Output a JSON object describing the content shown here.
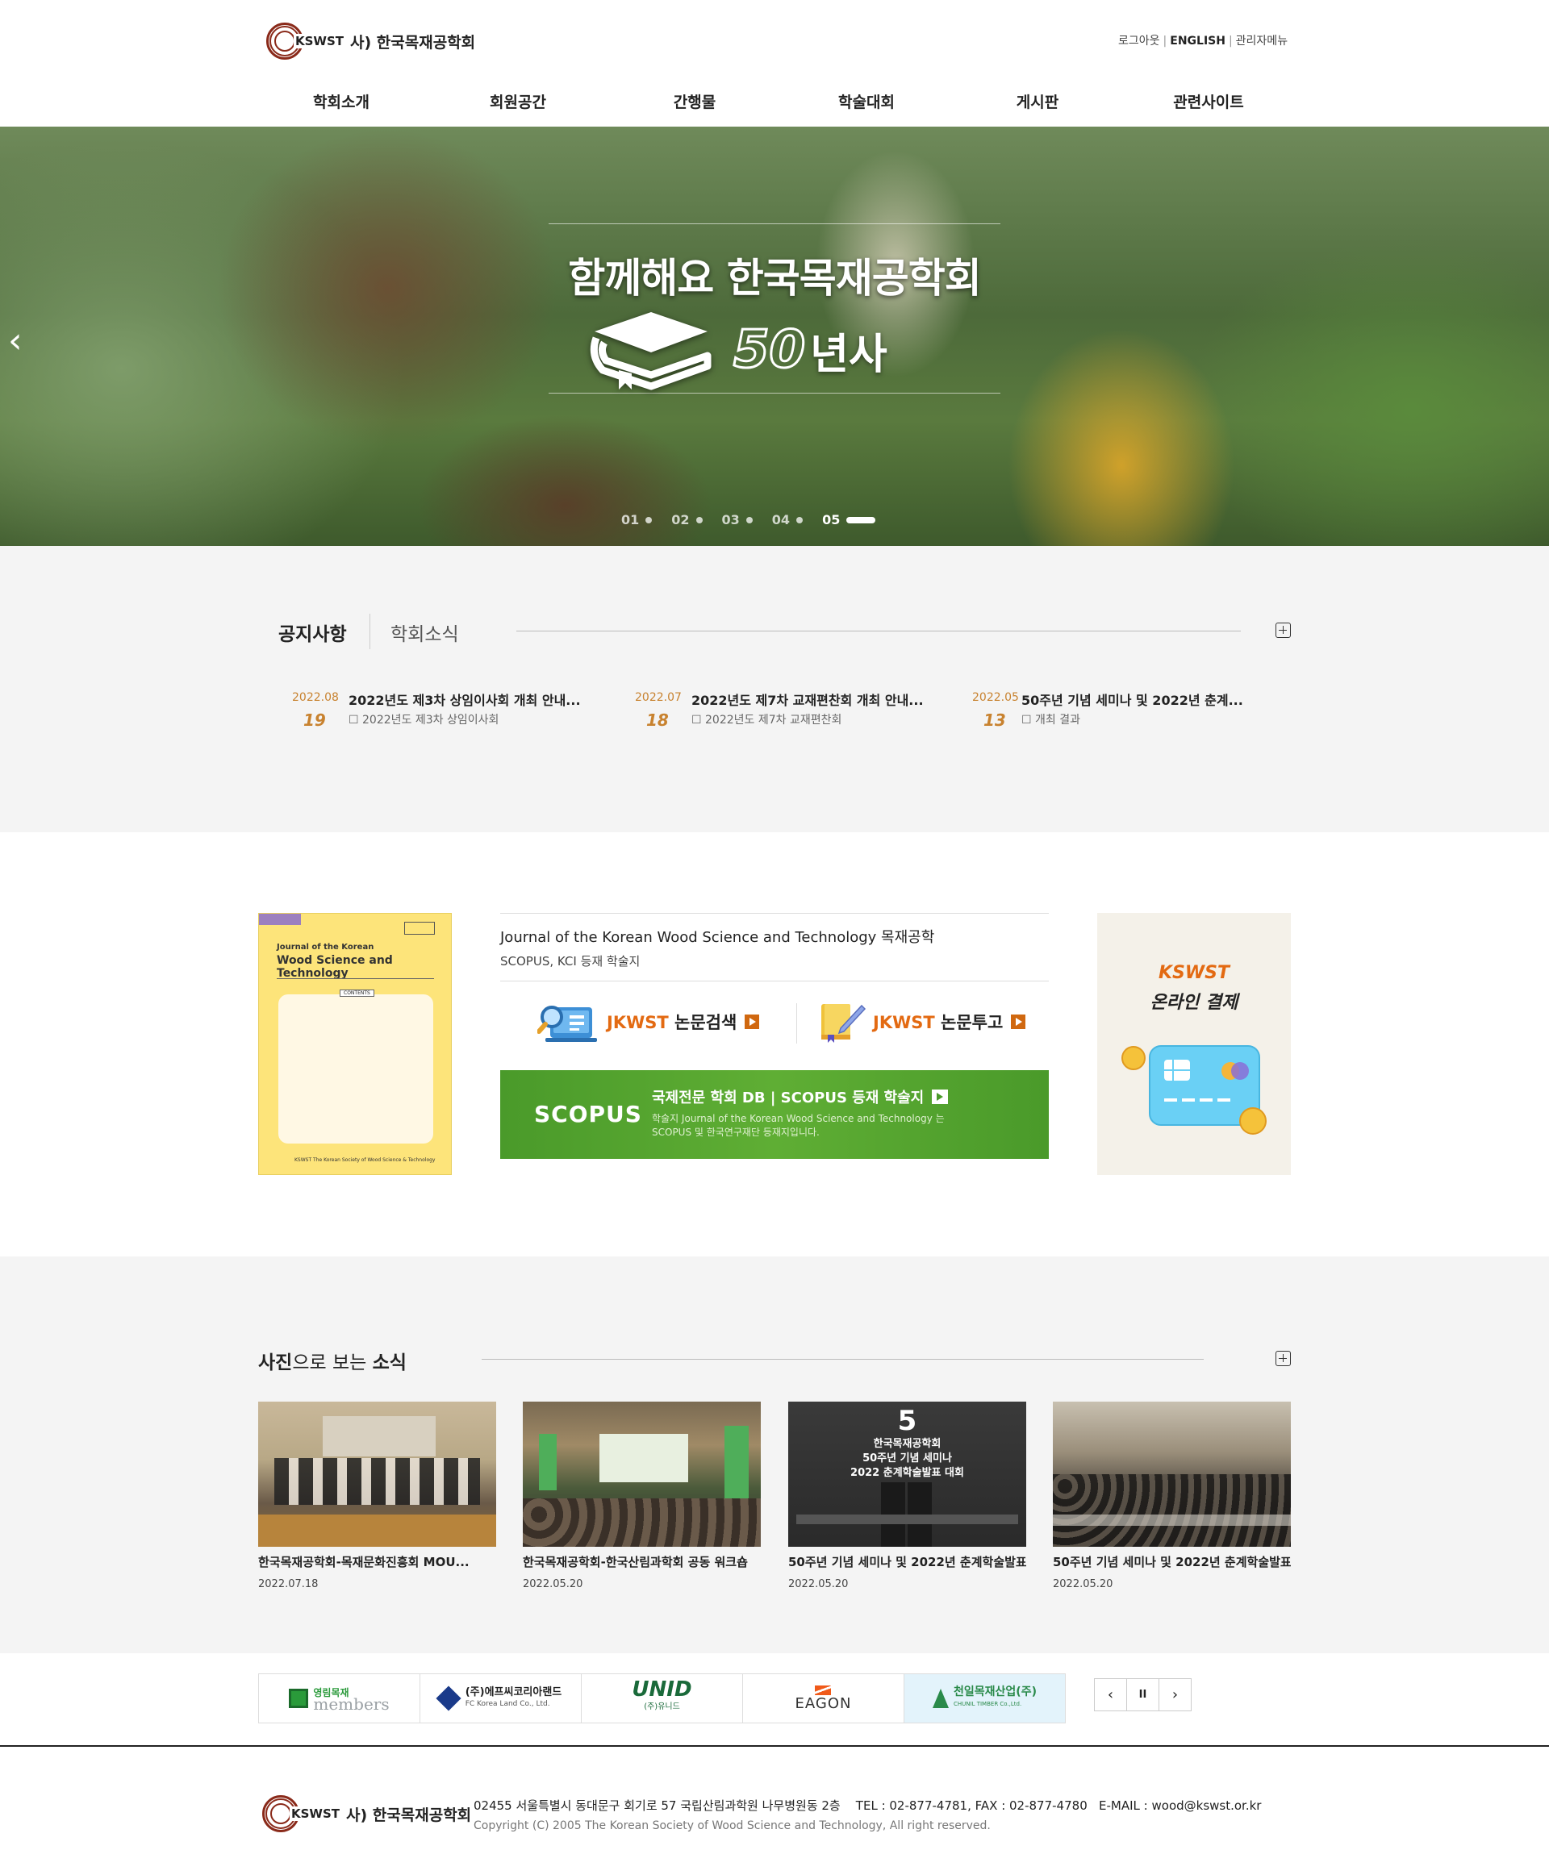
{
  "header": {
    "logo_abbr": "KSWST",
    "logo_name": "사) 한국목재공학회",
    "util": {
      "logout": "로그아웃",
      "english": "ENGLISH",
      "admin": "관리자메뉴"
    },
    "gnb": [
      "학회소개",
      "회원공간",
      "간행물",
      "학술대회",
      "게시판",
      "관련사이트"
    ]
  },
  "hero": {
    "title": "함께해요 한국목재공학회",
    "badge_number": "50",
    "badge_text": "년사",
    "slides": [
      "01",
      "02",
      "03",
      "04",
      "05"
    ],
    "active_slide": 5
  },
  "notice": {
    "tab_active": "공지사항",
    "tab_other": "학회소식",
    "items": [
      {
        "ym": "2022.08",
        "day": "19",
        "title": "2022년도 제3차 상임이사회 개최 안내...",
        "desc": "☐ 2022년도 제3차 상임이사회"
      },
      {
        "ym": "2022.07",
        "day": "18",
        "title": "2022년도 제7차 교재편찬회 개최 안내...",
        "desc": "☐ 2022년도 제7차 교재편찬회"
      },
      {
        "ym": "2022.05",
        "day": "13",
        "title": "50주년 기념 세미나 및 2022년 춘계...",
        "desc": "☐ 개최 결과"
      }
    ]
  },
  "journal": {
    "cover": {
      "top": "Journal of the Korean",
      "main": "Wood Science and Technology",
      "contents": "CONTENTS",
      "publisher": "KSWST The Korean Society of Wood Science & Technology"
    },
    "name": "Journal of the Korean Wood Science and Technology 목재공학",
    "index": "SCOPUS, KCI 등재 학술지",
    "search_btn": {
      "brand": "JKWST",
      "label": " 논문검색"
    },
    "submit_btn": {
      "brand": "JKWST",
      "label": " 논문투고"
    },
    "scopus": {
      "logo": "SCOPUS",
      "heading": "국제전문 학회 DB  |  SCOPUS 등재 학술지",
      "desc": "학술지 Journal of the Korean Wood Science and Technology 는 SCOPUS 및 한국연구재단 등재지입니다."
    },
    "pay": {
      "line1": "KSWST",
      "line2": "온라인 결제"
    }
  },
  "photo": {
    "title_b1": "사진",
    "title_mid": "으로 보는 ",
    "title_b2": "소식",
    "items": [
      {
        "caption": "한국목재공학회-목재문화진흥회 MOU...",
        "date": "2022.07.18"
      },
      {
        "caption": "한국목재공학회-한국산림과학회 공동 워크숍",
        "date": "2022.05.20"
      },
      {
        "caption": "50주년 기념 세미나 및 2022년 춘계학술발표...",
        "date": "2022.05.20"
      },
      {
        "caption": "50주년 기념 세미나 및 2022년 춘계학술발표...",
        "date": "2022.05.20"
      }
    ],
    "slide3_text": [
      "한국목재공학회",
      "50주년 기념 세미나",
      "2022 춘계학술발표 대회"
    ]
  },
  "partners": {
    "items": [
      {
        "name": "영림목재",
        "sub": "members"
      },
      {
        "name": "(주)에프씨코리아랜드",
        "sub": "FC Korea Land Co., Ltd."
      },
      {
        "name": "UNID",
        "sub": "(주)유니드"
      },
      {
        "name": "EAGON",
        "sub": ""
      },
      {
        "name": "천일목재산업(주)",
        "sub": "CHUNIL TIMBER Co.,Ltd."
      }
    ],
    "controls": {
      "prev": "‹",
      "pause": "II",
      "next": "›"
    }
  },
  "footer": {
    "address": "02455 서울특별시 동대문구 회기로 57 국립산림과학원 나무병원동 2층    TEL : 02-877-4781, FAX : 02-877-4780   E-MAIL : wood@kswst.or.kr",
    "copyright": "Copyright (C) 2005 The Korean Society of Wood Science and Technology, All right reserved."
  },
  "colors": {
    "accent": "#e36a12",
    "date": "#c8822f",
    "scopus": "#4a9a2a",
    "brand": "#8a2a1a"
  }
}
